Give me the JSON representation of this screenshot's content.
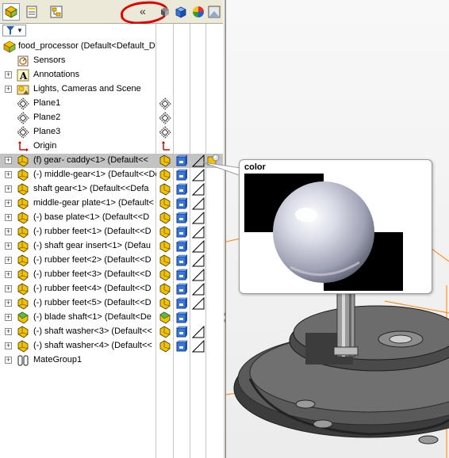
{
  "toolbar": {
    "tabs": [
      "feature-manager",
      "property-manager",
      "configuration-manager"
    ],
    "collapse_label": "«"
  },
  "filter": {
    "label": "▼"
  },
  "tree": {
    "items": [
      {
        "label": "food_processor  (Default<Default_D",
        "icon": "assembly-icon",
        "expander": ""
      },
      {
        "label": "Sensors",
        "icon": "sensors-icon",
        "expander": ""
      },
      {
        "label": "Annotations",
        "icon": "annotations-icon",
        "expander": "+"
      },
      {
        "label": "Lights, Cameras and Scene",
        "icon": "lights-icon",
        "expander": "+"
      },
      {
        "label": "Plane1",
        "icon": "plane-icon",
        "expander": ""
      },
      {
        "label": "Plane2",
        "icon": "plane-icon",
        "expander": ""
      },
      {
        "label": "Plane3",
        "icon": "plane-icon",
        "expander": ""
      },
      {
        "label": "Origin",
        "icon": "origin-icon",
        "expander": ""
      },
      {
        "label": "(f) gear- caddy<1> (Default<<",
        "icon": "part-icon",
        "expander": "+"
      },
      {
        "label": "(-) middle-gear<1> (Default<<De",
        "icon": "part-icon",
        "expander": "+"
      },
      {
        "label": "shaft gear<1> (Default<<Defa",
        "icon": "part-icon",
        "expander": "+"
      },
      {
        "label": "middle-gear plate<1> (Default<",
        "icon": "part-icon",
        "expander": "+"
      },
      {
        "label": "(-) base plate<1> (Default<<D",
        "icon": "part-icon",
        "expander": "+"
      },
      {
        "label": "(-) rubber feet<1> (Default<<D",
        "icon": "part-icon",
        "expander": "+"
      },
      {
        "label": "(-) shaft gear insert<1> (Defau",
        "icon": "part-icon",
        "expander": "+"
      },
      {
        "label": "(-) rubber feet<2> (Default<<D",
        "icon": "part-icon",
        "expander": "+"
      },
      {
        "label": "(-) rubber feet<3> (Default<<D",
        "icon": "part-icon",
        "expander": "+"
      },
      {
        "label": "(-) rubber feet<4> (Default<<D",
        "icon": "part-icon",
        "expander": "+"
      },
      {
        "label": "(-) rubber feet<5> (Default<<D",
        "icon": "part-icon",
        "expander": "+"
      },
      {
        "label": "(-) blade shaft<1> (Default<De",
        "icon": "part-icon",
        "expander": "+"
      },
      {
        "label": "(-) shaft washer<3> (Default<<",
        "icon": "part-icon",
        "expander": "+"
      },
      {
        "label": "(-) shaft washer<4> (Default<<",
        "icon": "part-icon",
        "expander": "+"
      },
      {
        "label": "MateGroup1",
        "icon": "mates-icon",
        "expander": "+"
      }
    ]
  },
  "tooltip": {
    "title": "color"
  },
  "colors": {
    "panel_bg": "#ffffff",
    "toolbar_bg": "#ece9d8",
    "selected_row": "#c3c3c3",
    "highlight_circle": "#e00000",
    "orange_lines": "#ff8000",
    "part_yellow": "#f2c200"
  }
}
